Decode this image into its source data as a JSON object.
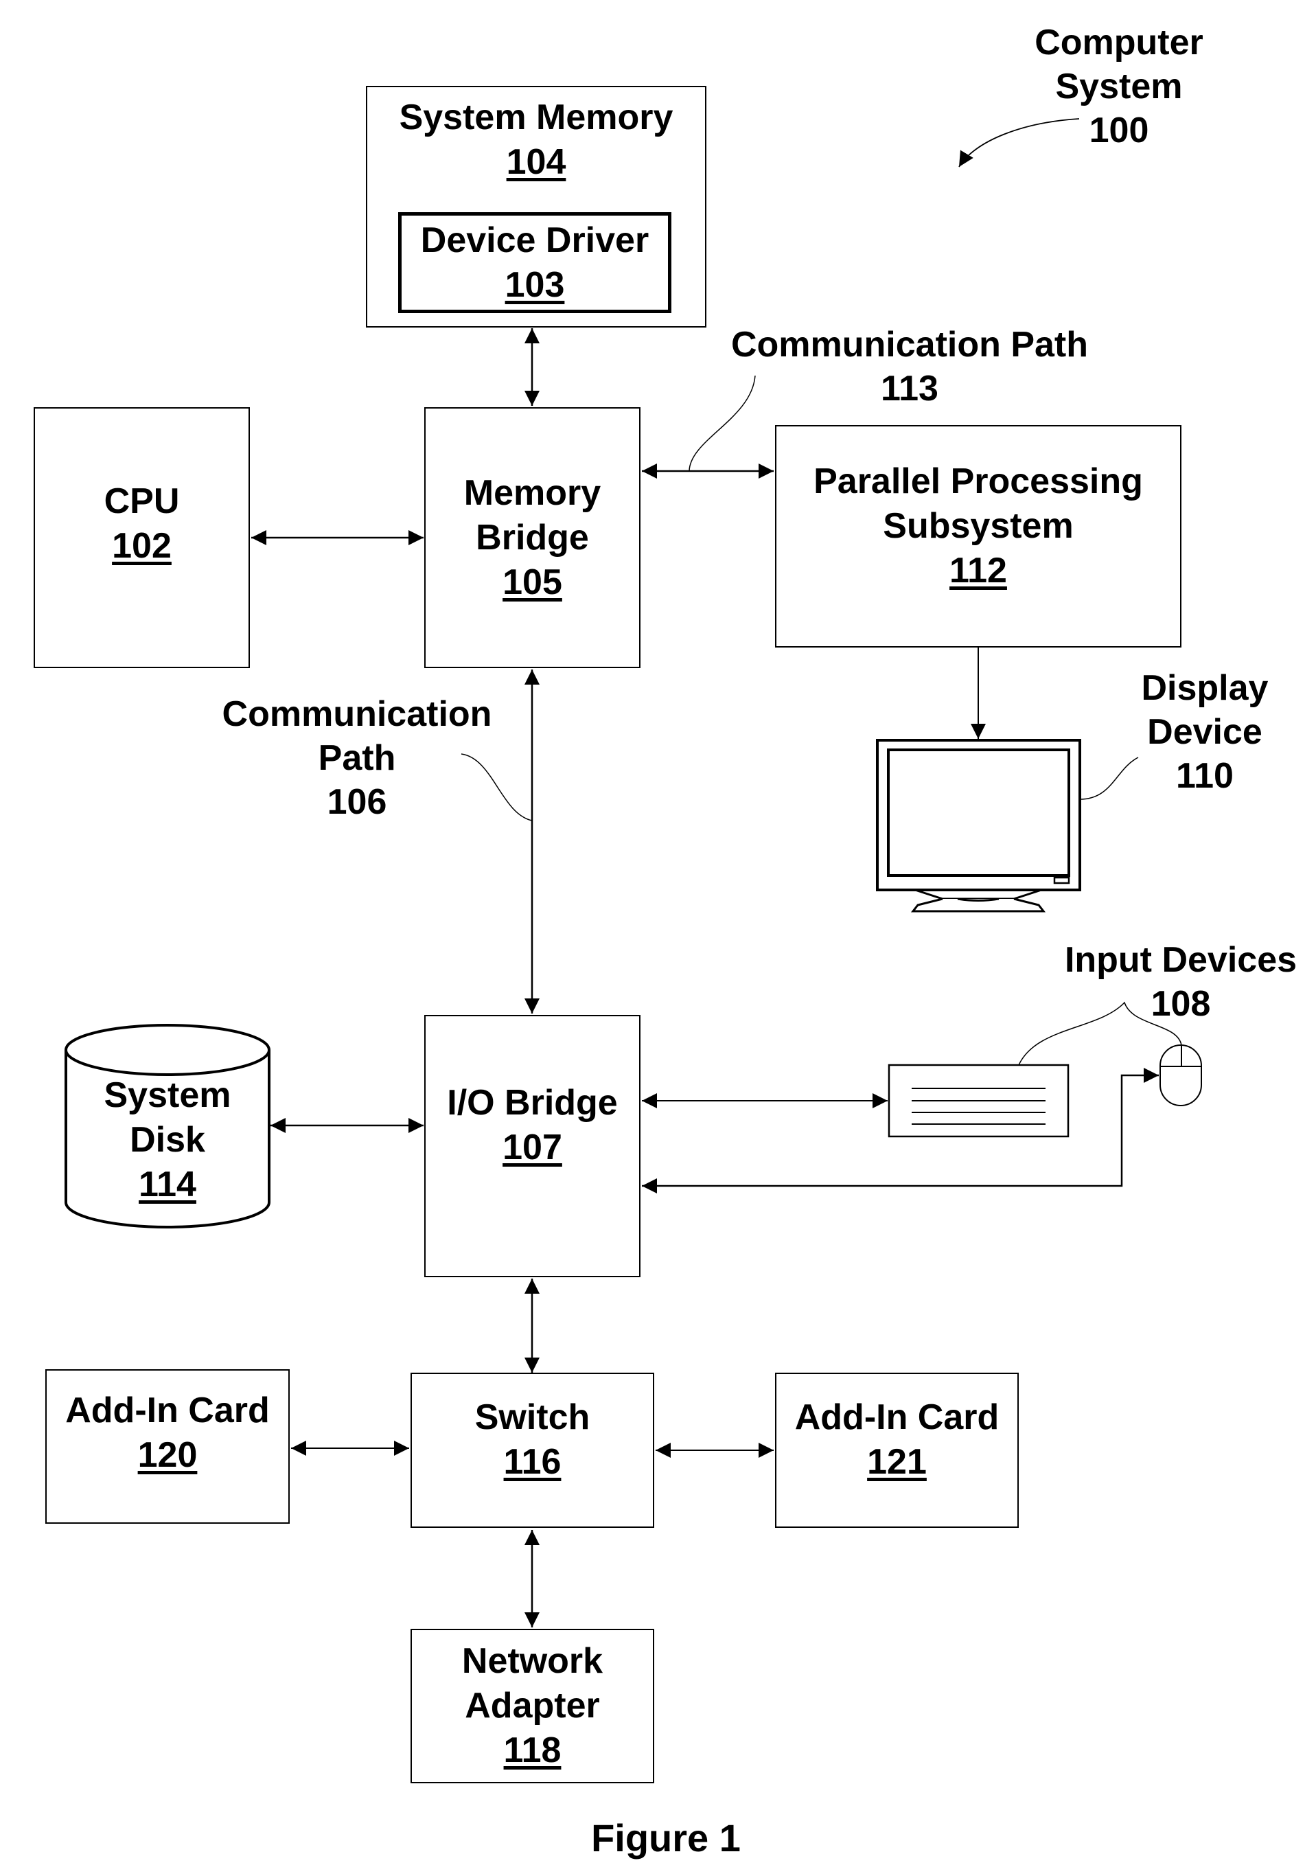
{
  "figure": {
    "caption": "Figure 1",
    "system": {
      "line1": "Computer",
      "line2": "System",
      "ref": "100"
    }
  },
  "blocks": {
    "system_memory": {
      "label": "System Memory",
      "ref": "104"
    },
    "device_driver": {
      "label": "Device Driver",
      "ref": "103"
    },
    "cpu": {
      "label": "CPU",
      "ref": "102"
    },
    "memory_bridge": {
      "line1": "Memory",
      "line2": "Bridge",
      "ref": "105"
    },
    "parallel_processing": {
      "line1": "Parallel Processing",
      "line2": "Subsystem",
      "ref": "112"
    },
    "io_bridge": {
      "label": "I/O Bridge",
      "ref": "107"
    },
    "system_disk": {
      "line1": "System",
      "line2": "Disk",
      "ref": "114"
    },
    "add_in_card_left": {
      "label": "Add-In Card",
      "ref": "120"
    },
    "switch": {
      "label": "Switch",
      "ref": "116"
    },
    "add_in_card_right": {
      "label": "Add-In Card",
      "ref": "121"
    },
    "network_adapter": {
      "line1": "Network",
      "line2": "Adapter",
      "ref": "118"
    }
  },
  "callouts": {
    "comm_path_113": {
      "line1": "Communication Path",
      "ref": "113"
    },
    "comm_path_106": {
      "line1": "Communication",
      "line2": "Path",
      "ref": "106"
    },
    "display_device": {
      "line1": "Display",
      "line2": "Device",
      "ref": "110"
    },
    "input_devices": {
      "line1": "Input Devices",
      "ref": "108"
    }
  },
  "icons": {
    "monitor": "display-monitor-icon",
    "keyboard": "keyboard-icon",
    "mouse": "mouse-icon",
    "disk": "disk-cylinder-icon"
  }
}
